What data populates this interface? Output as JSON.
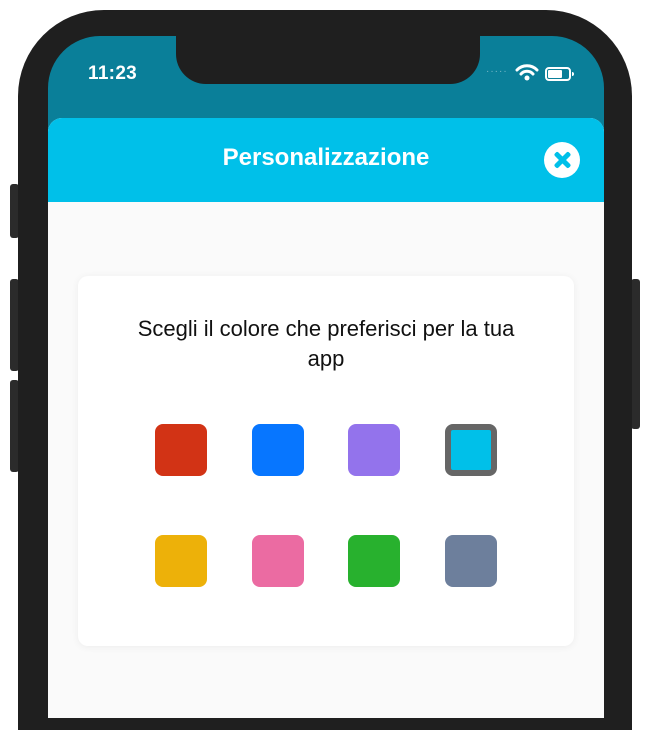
{
  "status_bar": {
    "time": "11:23",
    "signal": "·····"
  },
  "header": {
    "title": "Personalizzazione"
  },
  "card": {
    "prompt": "Scegli il colore che preferisci per la tua app",
    "swatches": [
      {
        "color": "#d23315",
        "selected": false
      },
      {
        "color": "#0776ff",
        "selected": false
      },
      {
        "color": "#9373ec",
        "selected": false
      },
      {
        "color": "#00c0e9",
        "selected": true
      },
      {
        "color": "#edb109",
        "selected": false
      },
      {
        "color": "#eb6ba2",
        "selected": false
      },
      {
        "color": "#28b12e",
        "selected": false
      },
      {
        "color": "#6d7f9c",
        "selected": false
      }
    ]
  },
  "colors": {
    "accent": "#00c0e9",
    "status_bar_bg": "#0a7f99",
    "selected_border": "#666666"
  }
}
